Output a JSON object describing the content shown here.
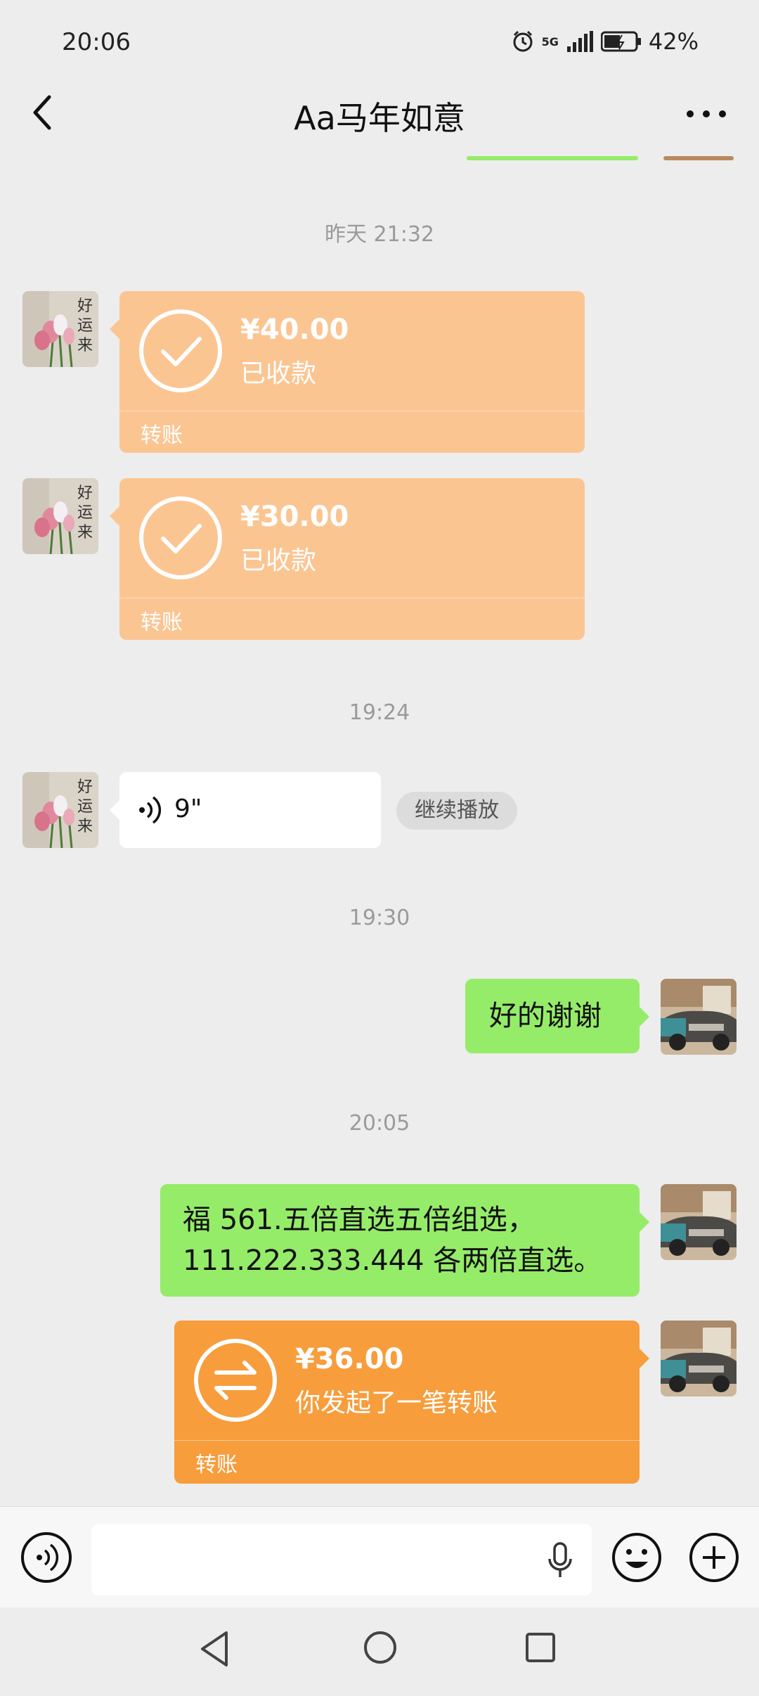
{
  "status_bar": {
    "time": "20:06",
    "network": "5G",
    "battery": "42%"
  },
  "header": {
    "title": "Aa马年如意"
  },
  "avatars": {
    "contact_text": "好运来"
  },
  "messages": {
    "ts1": "昨天 21:32",
    "transfer1": {
      "amount": "¥40.00",
      "status": "已收款",
      "kind": "转账"
    },
    "transfer2": {
      "amount": "¥30.00",
      "status": "已收款",
      "kind": "转账"
    },
    "ts2": "19:24",
    "voice": {
      "duration": "9\"",
      "continue_label": "继续播放"
    },
    "ts3": "19:30",
    "text1": "好的谢谢",
    "ts4": "20:05",
    "text2_line1": "福 561.五倍直选五倍组选，",
    "text2_line2": "111.222.333.444 各两倍直选。",
    "transfer3": {
      "amount": "¥36.00",
      "status": "你发起了一笔转账",
      "kind": "转账"
    }
  },
  "colors": {
    "received_transfer": "#fbc592",
    "sent_transfer": "#f79d3c",
    "sent_bubble": "#95ec69",
    "background": "#ededed"
  }
}
